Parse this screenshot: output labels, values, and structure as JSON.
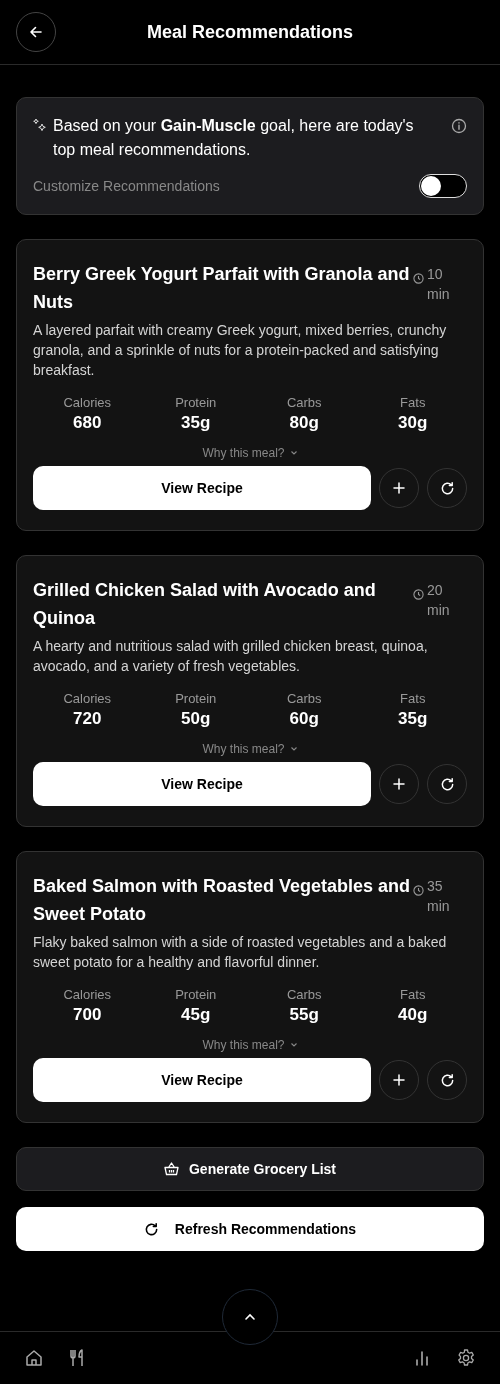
{
  "header": {
    "title": "Meal Recommendations"
  },
  "intro": {
    "text": "Based on your **Gain-Muscle** goal, here are today's top meal recommendations.",
    "customize_label": "Customize Recommendations",
    "customize_on": false
  },
  "meals": [
    {
      "title": "Berry Greek Yogurt Parfait with Granola and Nuts",
      "time": "10",
      "time_unit": "min",
      "description": "A layered parfait with creamy Greek yogurt, mixed berries, crunchy granola, and a sprinkle of nuts for a protein-packed and satisfying breakfast.",
      "macros": [
        {
          "label": "Calories",
          "value": "680"
        },
        {
          "label": "Protein",
          "value": "35g"
        },
        {
          "label": "Carbs",
          "value": "80g"
        },
        {
          "label": "Fats",
          "value": "30g"
        }
      ],
      "why": "Why this meal?",
      "button": "View Recipe"
    },
    {
      "title": "Grilled Chicken Salad with Avocado and Quinoa",
      "time": "20",
      "time_unit": "min",
      "description": "A hearty and nutritious salad with grilled chicken breast, quinoa, avocado, and a variety of fresh vegetables.",
      "macros": [
        {
          "label": "Calories",
          "value": "720"
        },
        {
          "label": "Protein",
          "value": "50g"
        },
        {
          "label": "Carbs",
          "value": "60g"
        },
        {
          "label": "Fats",
          "value": "35g"
        }
      ],
      "why": "Why this meal?",
      "button": "View Recipe"
    },
    {
      "title": "Baked Salmon with Roasted Vegetables and Sweet Potato",
      "time": "35",
      "time_unit": "min",
      "description": "Flaky baked salmon with a side of roasted vegetables and a baked sweet potato for a healthy and flavorful dinner.",
      "macros": [
        {
          "label": "Calories",
          "value": "700"
        },
        {
          "label": "Protein",
          "value": "45g"
        },
        {
          "label": "Carbs",
          "value": "55g"
        },
        {
          "label": "Fats",
          "value": "40g"
        }
      ],
      "why": "Why this meal?",
      "button": "View Recipe"
    }
  ],
  "actions": {
    "grocery": "Generate Grocery List",
    "refresh": "Refresh Recommendations"
  },
  "nav": [
    {
      "kind": "home"
    },
    {
      "kind": "meals"
    },
    {
      "kind": "stats"
    },
    {
      "kind": "settings"
    }
  ]
}
